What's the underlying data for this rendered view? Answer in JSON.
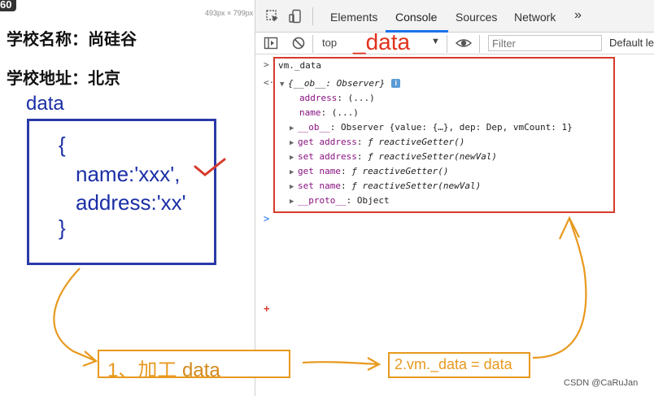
{
  "page": {
    "badge": "60",
    "dimensions": "493px × 799px",
    "school_name": "学校名称：尚硅谷",
    "school_address": "学校地址：北京",
    "data_label": "data",
    "code_lines": [
      "{",
      "name:'xxx',",
      "address:'xx'",
      "}"
    ]
  },
  "devtools": {
    "tabs": [
      "Elements",
      "Console",
      "Sources",
      "Network"
    ],
    "active_tab": "Console",
    "more_tabs": "»",
    "context": "top",
    "context_arrow": "▼",
    "filter_placeholder": "Filter",
    "levels": "Default le",
    "annotation": "_data",
    "console": {
      "prompt_symbol": ">",
      "result_symbol": "<·",
      "command": "vm._data",
      "object_header": "{__ob__: Observer}",
      "info": "i",
      "props": [
        {
          "key": "address",
          "value": "(...)"
        },
        {
          "key": "name",
          "value": "(...)"
        }
      ],
      "ob_key": "__ob__",
      "ob_value": "Observer {value: {…}, dep: Dep, vmCount: 1}",
      "accessors": [
        {
          "kind": "get",
          "key": "address",
          "fn": "reactiveGetter()"
        },
        {
          "kind": "set",
          "key": "address",
          "fn": "reactiveSetter(newVal)"
        },
        {
          "kind": "get",
          "key": "name",
          "fn": "reactiveGetter()"
        },
        {
          "kind": "set",
          "key": "name",
          "fn": "reactiveSetter(newVal)"
        }
      ],
      "proto_key": "__proto__",
      "proto_value": "Object",
      "caret": ">",
      "plus": "+"
    }
  },
  "annotations": {
    "step1_num": "1、",
    "step1_text": "加工",
    "step1_word": "data",
    "step2_text": "2.vm._data = data",
    "watermark": "CSDN @CaRuJan"
  },
  "colors": {
    "accent_blue": "#1a73e8",
    "code_blue": "#1b2fa6",
    "annotation_red": "#d63a2a",
    "annotation_orange": "#e8991e"
  }
}
